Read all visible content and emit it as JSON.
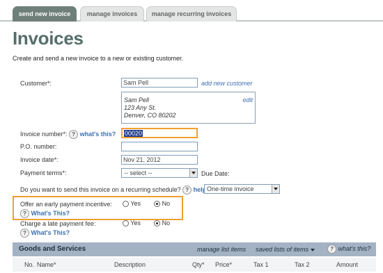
{
  "tabs": [
    {
      "label": "send new invoice",
      "active": true
    },
    {
      "label": "manage invoices",
      "active": false
    },
    {
      "label": "manage recurring invoices",
      "active": false
    }
  ],
  "page": {
    "title": "Invoices",
    "subtitle": "Create and send a new invoice to a new or existing customer."
  },
  "customer": {
    "label": "Customer*:",
    "value": "Sam Pell",
    "add_link": "add new customer",
    "address_line1": "Sam Pell",
    "address_line2": "123 Any St.",
    "address_line3": "Denver, CO 80202",
    "edit_link": "edit"
  },
  "invoice_number": {
    "label": "Invoice number*:",
    "help_link": "what's this?",
    "value": "00020"
  },
  "po_number": {
    "label": "P.O. number:",
    "value": ""
  },
  "invoice_date": {
    "label": "Invoice date*:",
    "value": "Nov 21, 2012"
  },
  "payment_terms": {
    "label": "Payment terms*:",
    "selected": "-- select --",
    "due_date_label": "Due Date:"
  },
  "recurring": {
    "question": "Do you want to send this invoice on a recurring schedule?",
    "help_link": "help",
    "selected": "One-time invoice"
  },
  "early_payment": {
    "label": "Offer an early payment incentive:",
    "yes": "Yes",
    "no": "No",
    "selected": "No",
    "help_link": "What's This?"
  },
  "late_fee": {
    "label": "Charge a late payment fee:",
    "yes": "Yes",
    "no": "No",
    "selected": "No",
    "help_link": "What's This?"
  },
  "help_icon_glyph": "?",
  "goods": {
    "title": "Goods and Services",
    "manage_link": "manage list items",
    "saved_link": "saved lists of items",
    "help_link": "what's this?",
    "columns": [
      "No.",
      "Name*",
      "Description",
      "Qty*",
      "Price*",
      "Tax 1",
      "Tax 2",
      "Amount"
    ]
  },
  "colors": {
    "accent_orange": "#f0a030",
    "title_color": "#556e6a",
    "bar_color": "#a3b3c4",
    "link_color": "#3d6fb0"
  },
  "icons": [
    "help-icon",
    "dropdown-arrow-icon",
    "radio-icon"
  ]
}
